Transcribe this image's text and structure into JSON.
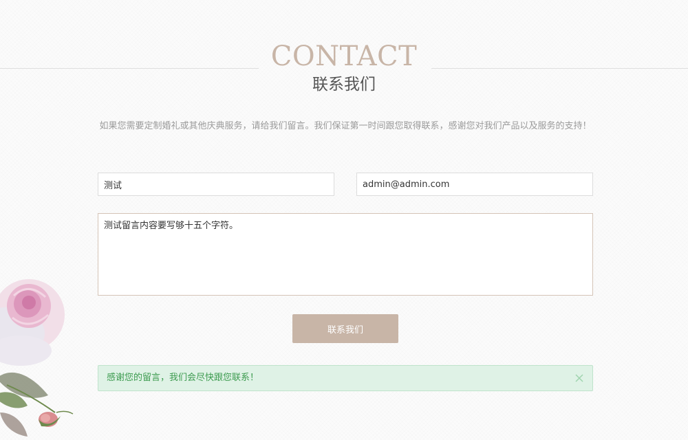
{
  "header": {
    "title_en": "CONTACT",
    "title_cn": "联系我们"
  },
  "intro_text": "如果您需要定制婚礼或其他庆典服务，请给我们留言。我们保证第一时间跟您取得联系，感谢您对我们产品以及服务的支持！",
  "form": {
    "name_value": "测试",
    "email_value": "admin@admin.com",
    "message_value": "测试留言内容要写够十五个字符。",
    "submit_label": "联系我们"
  },
  "alert": {
    "message": "感谢您的留言，我们会尽快跟您联系！",
    "close_icon": "close-icon"
  },
  "colors": {
    "accent": "#c8b5a7",
    "alert_bg": "#dff2e6",
    "alert_text": "#3c9b4f"
  },
  "decoration": {
    "icon": "rose-flower-illustration"
  }
}
